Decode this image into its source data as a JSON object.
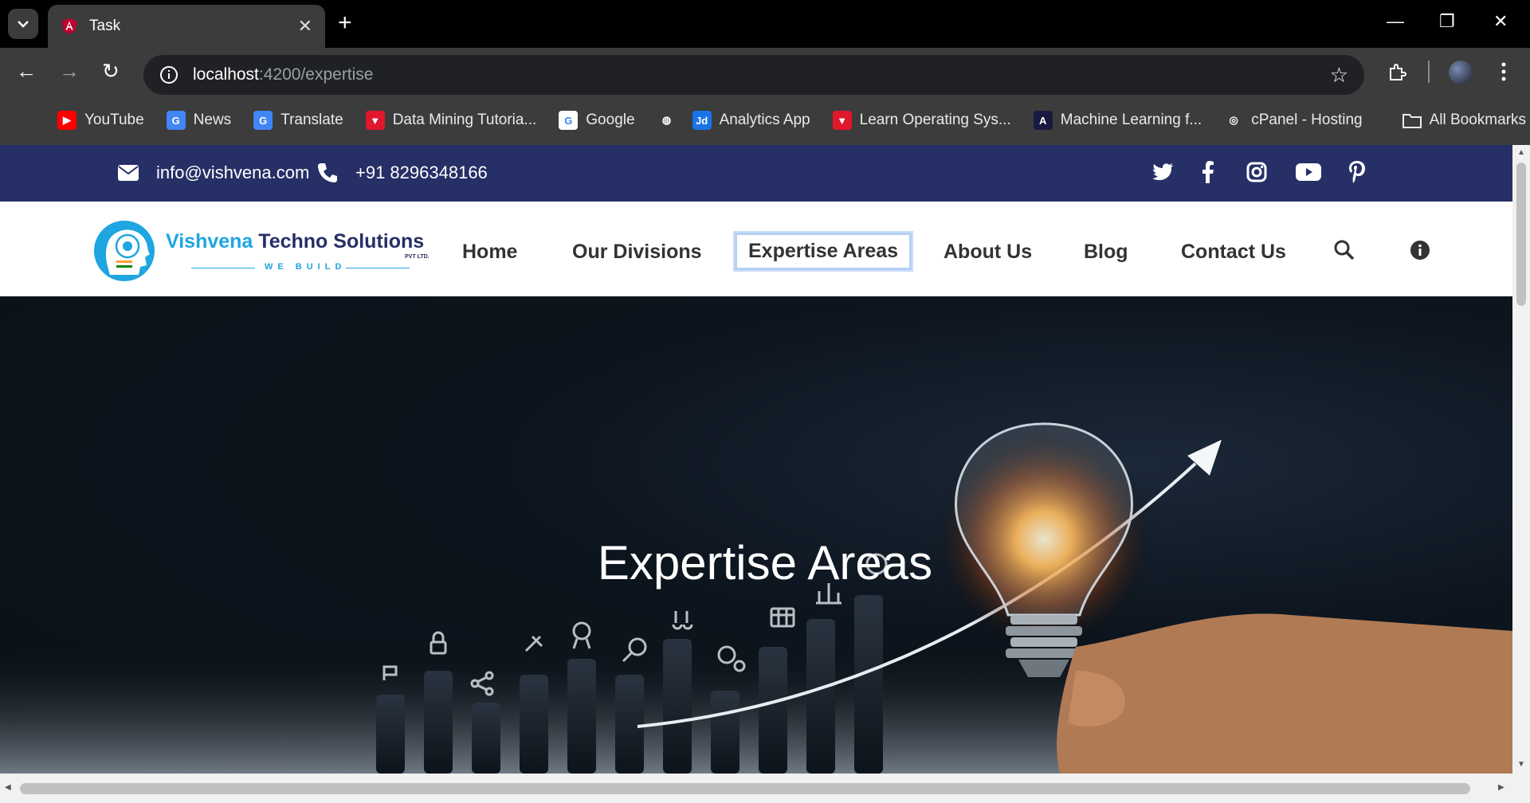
{
  "browser": {
    "tab_title": "Task",
    "close_glyph": "✕",
    "newtab_glyph": "+",
    "window": {
      "minimize": "—",
      "restore": "❐",
      "close": "✕"
    },
    "nav": {
      "back": "←",
      "forward": "→",
      "reload": "↻"
    },
    "url_host": "localhost",
    "url_path": ":4200/expertise",
    "star": "☆",
    "bookmarks": [
      {
        "label": "YouTube",
        "icon": "youtube-icon",
        "color": "#ff0000",
        "glyph": "▶"
      },
      {
        "label": "News",
        "icon": "news-icon",
        "color": "#4285f4",
        "glyph": "G"
      },
      {
        "label": "Translate",
        "icon": "translate-icon",
        "color": "#4285f4",
        "glyph": "G"
      },
      {
        "label": "Data Mining Tutoria...",
        "icon": "tutorial-icon",
        "color": "#e0172d",
        "glyph": "▼"
      },
      {
        "label": "Google",
        "icon": "google-icon",
        "color": "#ffffff",
        "glyph": "G"
      },
      {
        "label": "",
        "icon": "globe-icon",
        "color": "#3c3c3c",
        "glyph": "◍"
      },
      {
        "label": "Analytics App",
        "icon": "analytics-icon",
        "color": "#1a73e8",
        "glyph": "Jd"
      },
      {
        "label": "Learn Operating Sys...",
        "icon": "tutorial-icon",
        "color": "#e0172d",
        "glyph": "▼"
      },
      {
        "label": "Machine Learning f...",
        "icon": "ml-icon",
        "color": "#1a1a40",
        "glyph": "A"
      },
      {
        "label": "cPanel - Hosting",
        "icon": "cpanel-icon",
        "color": "#3c3c3c",
        "glyph": "◎"
      }
    ],
    "all_bookmarks": "All Bookmarks"
  },
  "site": {
    "email": "info@vishvena.com",
    "phone": "+91 8296348166",
    "logo": {
      "brand": "Vishvena",
      "brand2": "Techno Solutions",
      "suffix": "PVT LTD.",
      "tagline": "WE BUILD"
    },
    "nav": [
      "Home",
      "Our Divisions",
      "Expertise Areas",
      "About Us",
      "Blog",
      "Contact Us"
    ],
    "active_nav": "Expertise Areas",
    "hero_title": "Expertise Areas"
  },
  "colors": {
    "topbar": "#262f66",
    "accent": "#1fa5e0",
    "nav_active_border": "#b5d0f4"
  }
}
